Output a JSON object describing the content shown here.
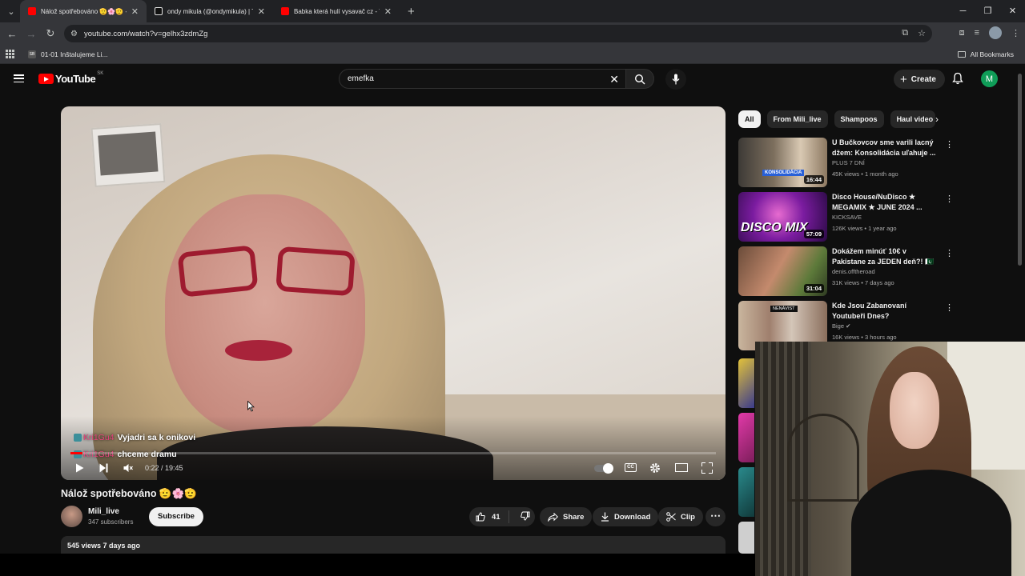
{
  "browser": {
    "tabs": [
      {
        "title": "Nálož spotřebováno 🫡🌸🫡 - YouTube",
        "fav": "#ff0000",
        "active": true
      },
      {
        "title": "ondy mikula (@ondymikula) | TikTok",
        "fav": "#111111",
        "active": false
      },
      {
        "title": "Babka která hulí vysavač cz - YouTube",
        "fav": "#ff0000",
        "active": false
      }
    ],
    "url": "youtube.com/watch?v=gelhx3zdmZg",
    "bookmark": "01-01 Inštalujeme Li...",
    "bookmark_fav": "SB",
    "all_bookmarks": "All Bookmarks"
  },
  "header": {
    "logo": "YouTube",
    "country": "SK",
    "search_value": "emefka",
    "create": "Create",
    "avatar_letter": "M"
  },
  "player": {
    "chat": [
      {
        "user": "Kri1Gu4",
        "message": "Vyjadri sa k onikovi"
      },
      {
        "user": "Kri1Gu4",
        "message": "chceme dramu"
      }
    ],
    "time": "0:22 / 19:45",
    "progress_fraction": 0.019
  },
  "video": {
    "title": "Nálož spotřebováno 🫡🌸🫡",
    "channel": "Mili_live",
    "subscribers": "347 subscribers",
    "subscribe": "Subscribe",
    "likes": "41",
    "share": "Share",
    "download": "Download",
    "clip": "Clip",
    "meta": "545 views  7 days ago"
  },
  "chips": [
    "All",
    "From Mili_live",
    "Shampoos",
    "Haul video"
  ],
  "recommendations": [
    {
      "title": "U Bučkovcov sme varili lacný džem: Konsolidácia uľahuje ...",
      "channel": "PLUS 7 DNÍ",
      "meta": "45K views • 1 month ago",
      "duration": "16:44",
      "tag": "KONSOLIDÁCIA"
    },
    {
      "title": "Disco House/NuDisco ★ MEGAMIX ★ JUNE 2024 ...",
      "channel": "KICKSAVE",
      "meta": "126K views • 1 year ago",
      "duration": "57:09",
      "tag": "DISCO MIX"
    },
    {
      "title": "Dokážem minúť 10€ v Pakistane za JEDEN deň?! 🇵🇰",
      "channel": "denis.offtheroad",
      "meta": "31K views • 7 days ago",
      "duration": "31:04",
      "tag": ""
    },
    {
      "title": "Kde Jsou Zabanovaní Youtubeři Dnes?",
      "channel": "Bige ✔",
      "meta": "16K views • 3 hours ago",
      "duration": "",
      "tag": "NENÁVIST"
    }
  ]
}
